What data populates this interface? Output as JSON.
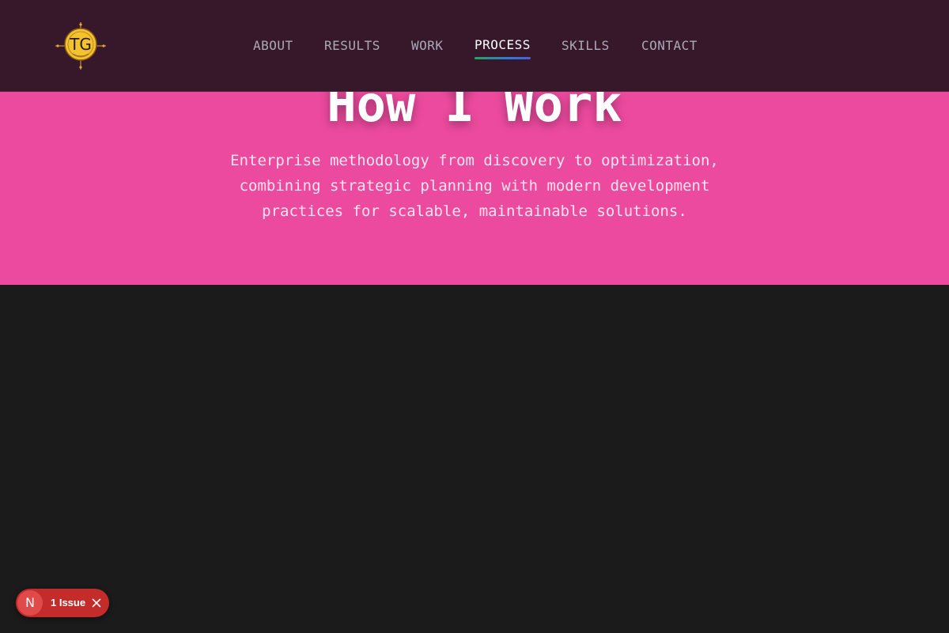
{
  "header": {
    "logo": {
      "text": "TG",
      "icon": "compass-logo-icon",
      "color": "#f2c230"
    },
    "nav": [
      {
        "id": "about",
        "label": "ABOUT",
        "active": false
      },
      {
        "id": "results",
        "label": "RESULTS",
        "active": false
      },
      {
        "id": "work",
        "label": "WORK",
        "active": false
      },
      {
        "id": "process",
        "label": "PROCESS",
        "active": true
      },
      {
        "id": "skills",
        "label": "SKILLS",
        "active": false
      },
      {
        "id": "contact",
        "label": "CONTACT",
        "active": false
      }
    ]
  },
  "hero": {
    "title": "How I Work",
    "subtitle": "Enterprise methodology from discovery to optimization, combining strategic planning with modern development practices for scalable, maintainable solutions."
  },
  "dev_indicator": {
    "badge_letter": "N",
    "issues_label": "1 Issue",
    "close_icon": "close-icon"
  },
  "colors": {
    "header_bg": "#37172a",
    "hero_bg": "#ec4a9e",
    "page_bg": "#1b1b1b",
    "nav_text": "#a9abb8",
    "nav_active": "#ffffff",
    "underline_start": "#22a85c",
    "underline_end": "#4a5fd8",
    "issue_bg": "#c42b2b"
  }
}
